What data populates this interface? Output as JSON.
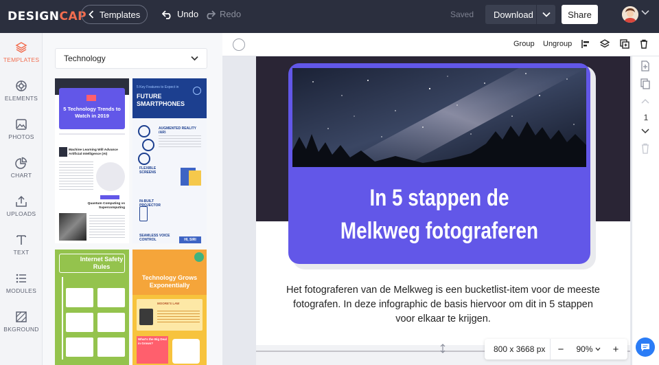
{
  "topbar": {
    "logo_main": "DESIGN",
    "logo_accent": "CAP",
    "back_label": "Templates",
    "undo_label": "Undo",
    "redo_label": "Redo",
    "saved_label": "Saved",
    "download_label": "Download",
    "share_label": "Share"
  },
  "rail": {
    "items": [
      {
        "label": "TEMPLATES",
        "icon": "layers-icon"
      },
      {
        "label": "ELEMENTS",
        "icon": "elements-icon"
      },
      {
        "label": "PHOTOS",
        "icon": "photo-icon"
      },
      {
        "label": "CHART",
        "icon": "chart-icon"
      },
      {
        "label": "UPLOADS",
        "icon": "upload-icon"
      },
      {
        "label": "TEXT",
        "icon": "text-icon"
      },
      {
        "label": "MODULES",
        "icon": "modules-icon"
      },
      {
        "label": "BKGROUND",
        "icon": "background-icon"
      }
    ]
  },
  "panel": {
    "category": "Technology",
    "templates": [
      {
        "title": "5 Technology Trends to Watch in 2019",
        "sub1": "Machine Learning Will Advance Artificial Intelligence (AI)",
        "sub2": "Quantum Computing vs Supercomputing"
      },
      {
        "title_small": "5 Key Features to Expect in",
        "title": "FUTURE SMARTPHONES",
        "items": [
          "AUGMENTED REALITY (AR)",
          "FLEXIBLE SCREENS",
          "IN-BUILT PROJECTOR",
          "SEAMLESS VOICE CONTROL"
        ],
        "tag": "HI, SIRI"
      },
      {
        "title": "Internet Safety Rules"
      },
      {
        "title": "Technology Grows Exponentially",
        "sub1": "MOORE'S LAW",
        "sub2": "What's the Big Deal in Grows?"
      }
    ]
  },
  "canvas_toolbar": {
    "group_label": "Group",
    "ungroup_label": "Ungroup"
  },
  "design": {
    "headline_line1": "In 5 stappen de",
    "headline_line2": "Melkweg fotograferen",
    "body": "Het fotograferen van de Melkweg is een bucketlist-item voor de meeste fotografen. In deze infographic de basis hiervoor om dit in 5 stappen voor elkaar te krijgen.",
    "colors": {
      "card": "#6257e8",
      "band": "#2a2535"
    }
  },
  "right_rail": {
    "page_number": "1"
  },
  "zoombar": {
    "dimensions": "800 x 3668 px",
    "minus": "−",
    "zoom": "90%",
    "plus": "+"
  },
  "colors": {
    "accent": "#f26d4f",
    "topbar": "#2b2f3e",
    "chat": "#2b7cf6"
  }
}
